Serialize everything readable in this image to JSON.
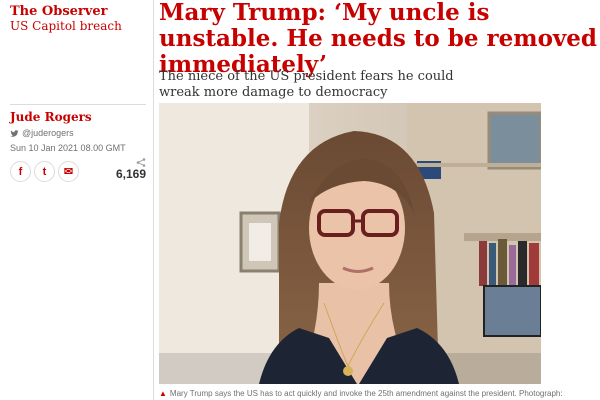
{
  "section": {
    "title": "The Observer",
    "subtitle": "US Capitol breach"
  },
  "byline": {
    "author": "Jude Rogers",
    "handle": "@juderogers",
    "date": "Sun 10 Jan 2021 08.00 GMT"
  },
  "share": {
    "buttons": [
      {
        "icon": "facebook-icon",
        "glyph": "f"
      },
      {
        "icon": "twitter-icon",
        "glyph": "t"
      },
      {
        "icon": "email-icon",
        "glyph": "✉"
      }
    ],
    "count": "6,169"
  },
  "article": {
    "headline": "Mary Trump: ‘My uncle is unstable. He needs to be removed immediately’",
    "standfirst": "The niece of the US president fears he could wreak more damage to democracy"
  },
  "image": {
    "caption": "Mary Trump says the US has to act quickly and invoke the 25th amendment against the president. Photograph:",
    "caption_marker": "▲"
  },
  "colors": {
    "accent": "#c70000",
    "text": "#121212",
    "muted": "#707070"
  }
}
